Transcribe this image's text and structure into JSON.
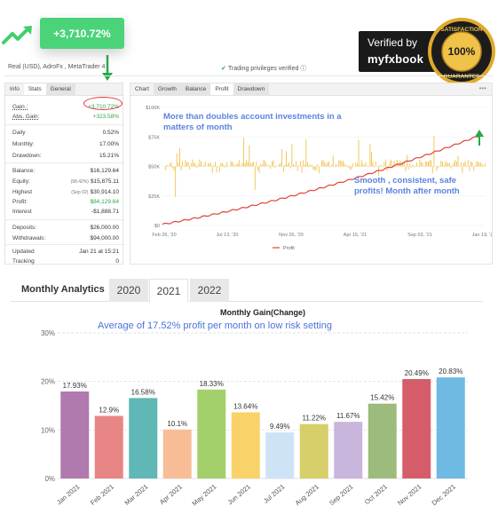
{
  "header": {
    "gain_badge": "+3,710.72%",
    "verified_line1": "Verified by",
    "verified_line2": "myfxbook",
    "seal_top": "SATISFACTION",
    "seal_mid": "100%",
    "seal_bottom": "GUARANTEE",
    "account_info": "Real (USD), AdroFx , MetaTrader 4",
    "privileges": "Trading privileges verified"
  },
  "colors": {
    "accent_green": "#4bd37a",
    "anno_blue": "#5a84e0",
    "profit_line": "#e0433a",
    "growth_bars": "#f1c24a"
  },
  "stats": {
    "tabs": [
      "Info",
      "Stats",
      "General"
    ],
    "rows": [
      {
        "key": "Gain :",
        "value": "+3,710.72%",
        "note": ""
      },
      {
        "key": "Abs. Gain:",
        "value": "+323.58%",
        "note": ""
      },
      {
        "key": "Daily",
        "value": "0.52%",
        "note": ""
      },
      {
        "key": "Monthly:",
        "value": "17.00%",
        "note": ""
      },
      {
        "key": "Drawdown:",
        "value": "15.21%",
        "note": ""
      },
      {
        "key": "Balance:",
        "value": "$16,129.64",
        "note": ""
      },
      {
        "key": "Equity:",
        "value": "$15,875.11",
        "note": "(98.42%)"
      },
      {
        "key": "Highest",
        "value": "$30,914.10",
        "note": "(Sep 02)"
      },
      {
        "key": "Profit:",
        "value": "$84,129.64",
        "note": ""
      },
      {
        "key": "Interest",
        "value": "-$1,888.71",
        "note": ""
      },
      {
        "key": "Deposits:",
        "value": "$26,000.00",
        "note": ""
      },
      {
        "key": "Withdrawals:",
        "value": "$94,000.00",
        "note": ""
      },
      {
        "key": "Updated",
        "value": "Jan 21 at 15:21",
        "note": ""
      },
      {
        "key": "Tracking",
        "value": "0",
        "note": ""
      }
    ]
  },
  "chart_tabs": [
    "Chart",
    "Growth",
    "Balance",
    "Profit",
    "Drawdown"
  ],
  "chart_menu": "•••",
  "profit_chart": {
    "annotation_top": [
      "More than doubles account  investments in a",
      "matters of month"
    ],
    "annotation_bottom": [
      "Smooth , consistent, safe",
      "profits!  Month after month"
    ],
    "legend": "Profit",
    "y_ticks": [
      "$100K",
      "$75K",
      "$50K",
      "$25K",
      "$0"
    ],
    "x_ticks": [
      "Feb 26, '20",
      "Jul 13, '20",
      "Nov 26, '20",
      "Apr 15, '21",
      "Sep 03, '21",
      "Jan 19, '22"
    ]
  },
  "analytics": {
    "title": "Monthly Analytics",
    "years": [
      "2020",
      "2021",
      "2022"
    ],
    "selected_year": "2021"
  },
  "chart_data": {
    "type": "bar",
    "title": "Monthly Gain(Change)",
    "annotation": "Average of 17.52% profit per month on low risk setting",
    "categories": [
      "Jan 2021",
      "Feb 2021",
      "Mar 2021",
      "Apr 2021",
      "May 2021",
      "Jun 2021",
      "Jul 2021",
      "Aug 2021",
      "Sep 2021",
      "Oct 2021",
      "Nov 2021",
      "Dec 2021"
    ],
    "values": [
      17.93,
      12.9,
      16.58,
      10.1,
      18.33,
      13.64,
      9.49,
      11.22,
      11.67,
      15.42,
      20.49,
      20.83
    ],
    "value_labels": [
      "17.93%",
      "12.9%",
      "16.58%",
      "10.1%",
      "18.33%",
      "13.64%",
      "9.49%",
      "11.22%",
      "11.67%",
      "15.42%",
      "20.49%",
      "20.83%"
    ],
    "colors": [
      "#b07aae",
      "#e88585",
      "#5fb8b5",
      "#f8bd96",
      "#a3d06b",
      "#f9d36a",
      "#cfe3f7",
      "#d6cf6a",
      "#c8b6dc",
      "#9dbb7c",
      "#d55d6a",
      "#6fbae2"
    ],
    "y_ticks": [
      "30%",
      "20%",
      "10%",
      "0%"
    ],
    "ylim": [
      0,
      30
    ]
  }
}
